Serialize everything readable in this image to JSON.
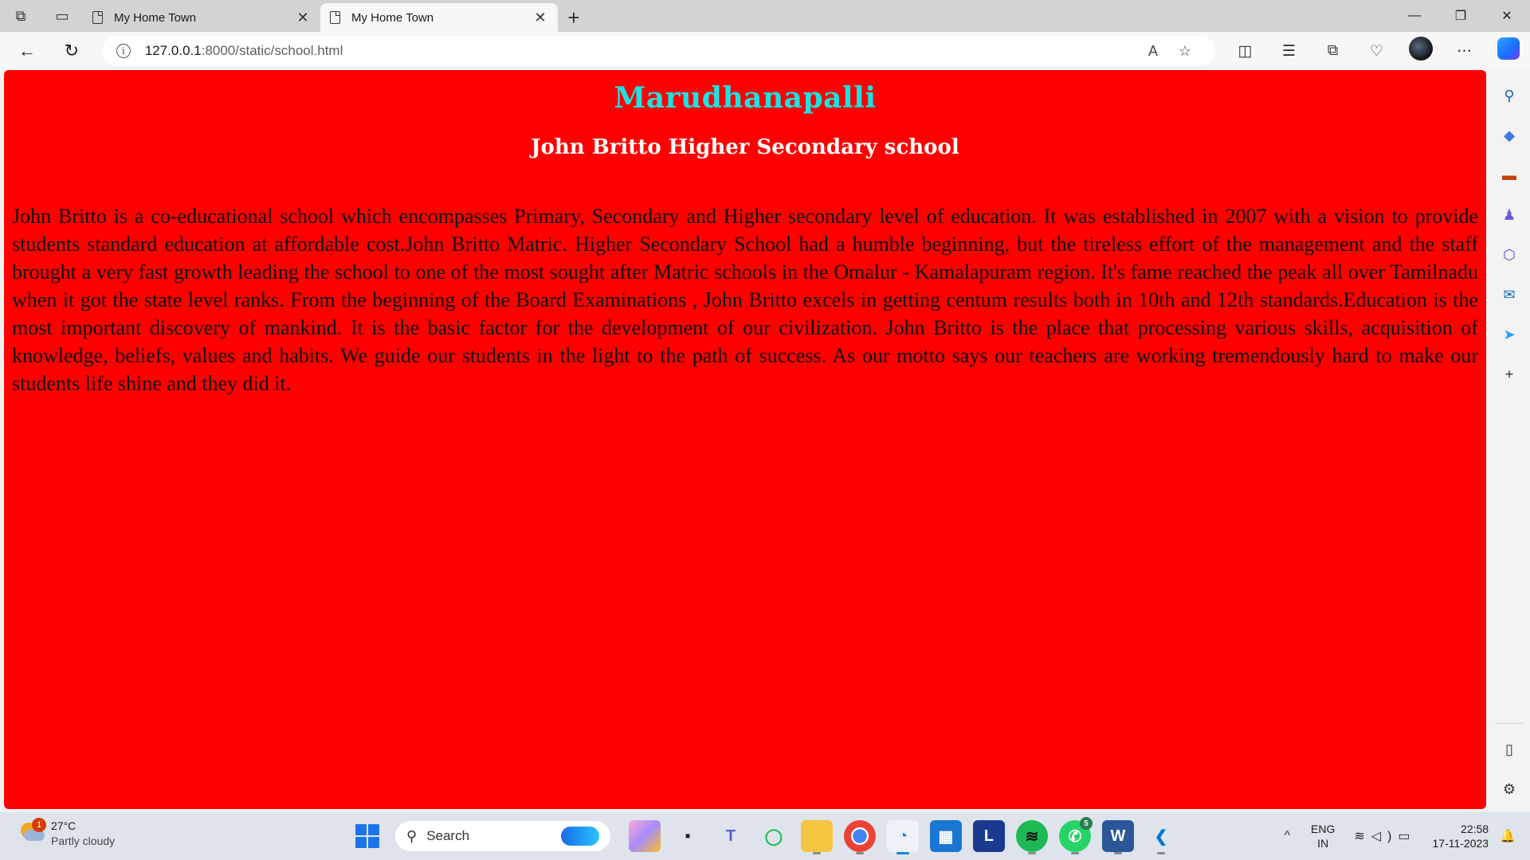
{
  "browser": {
    "tabs": [
      {
        "title": "My Home Town",
        "active": false
      },
      {
        "title": "My Home Town",
        "active": true
      }
    ],
    "url_host": "127.0.0.1",
    "url_path": ":8000/static/school.html",
    "window_controls": [
      "minimize-icon",
      "restore-icon",
      "close-icon"
    ]
  },
  "page": {
    "title": "Marudhanapalli",
    "subtitle": "John Britto Higher Secondary school",
    "paragraph": "John Britto is a co-educational school which encompasses Primary, Secondary and Higher secondary level of education. It was established in 2007 with a vision to provide students standard education at affordable cost.John Britto Matric. Higher Secondary School had a humble beginning, but the tireless effort of the management and the staff brought a very fast growth leading the school to one of the most sought after Matric schools in the Omalur - Kamalapuram region. It's fame reached the peak all over Tamilnadu when it got the state level ranks. From the beginning of the Board Examinations , John Britto excels in getting centum results both in 10th and 12th standards.Education is the most important discovery of mankind. It is the basic factor for the development of our civilization. John Britto is the place that processing various skills, acquisition of knowledge, beliefs, values and habits. We guide our students in the light to the path of success. As our motto says our teachers are working tremendously hard to make our students life shine and they did it.",
    "colors": {
      "background": "#ff0000",
      "title": "#19e3e3",
      "subtitle": "#ffffff",
      "text": "#111111"
    }
  },
  "taskbar": {
    "weather": {
      "badge": "1",
      "temp": "27°C",
      "condition": "Partly cloudy"
    },
    "search_placeholder": "Search",
    "whatsapp_badge": "5",
    "language": {
      "line1": "ENG",
      "line2": "IN"
    },
    "clock": {
      "time": "22:58",
      "date": "17-11-2023"
    }
  }
}
